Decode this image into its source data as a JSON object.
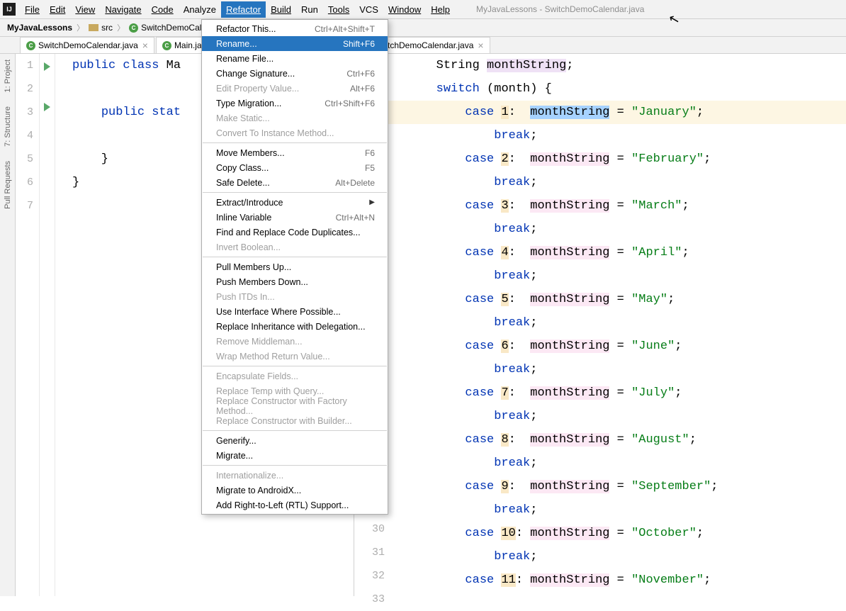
{
  "window": {
    "title": "MyJavaLessons - SwitchDemoCalendar.java"
  },
  "menus": {
    "file": "File",
    "edit": "Edit",
    "view": "View",
    "navigate": "Navigate",
    "code": "Code",
    "analyze": "Analyze",
    "refactor": "Refactor",
    "build": "Build",
    "run": "Run",
    "tools": "Tools",
    "vcs": "VCS",
    "window": "Window",
    "help": "Help"
  },
  "breadcrumb": {
    "project": "MyJavaLessons",
    "src": "src",
    "cls": "SwitchDemoCalendar"
  },
  "tabs": {
    "left1": "SwitchDemoCalendar.java",
    "left2": "Main.jav",
    "right1": "tchDemoCalendar.java"
  },
  "sidebar": {
    "project": "1: Project",
    "structure": "7: Structure",
    "pull": "Pull Requests"
  },
  "dropdown": [
    {
      "label": "Refactor This...",
      "short": "Ctrl+Alt+Shift+T",
      "type": "item"
    },
    {
      "label": "Rename...",
      "short": "Shift+F6",
      "type": "highlighted"
    },
    {
      "label": "Rename File...",
      "type": "item"
    },
    {
      "label": "Change Signature...",
      "short": "Ctrl+F6",
      "type": "item"
    },
    {
      "label": "Edit Property Value...",
      "short": "Alt+F6",
      "type": "disabled"
    },
    {
      "label": "Type Migration...",
      "short": "Ctrl+Shift+F6",
      "type": "item"
    },
    {
      "label": "Make Static...",
      "type": "disabled"
    },
    {
      "label": "Convert To Instance Method...",
      "type": "disabled"
    },
    {
      "type": "sep"
    },
    {
      "label": "Move Members...",
      "short": "F6",
      "type": "item"
    },
    {
      "label": "Copy Class...",
      "short": "F5",
      "type": "item"
    },
    {
      "label": "Safe Delete...",
      "short": "Alt+Delete",
      "type": "item"
    },
    {
      "type": "sep"
    },
    {
      "label": "Extract/Introduce",
      "type": "submenu"
    },
    {
      "label": "Inline Variable",
      "short": "Ctrl+Alt+N",
      "type": "item"
    },
    {
      "label": "Find and Replace Code Duplicates...",
      "type": "item"
    },
    {
      "label": "Invert Boolean...",
      "type": "disabled"
    },
    {
      "type": "sep"
    },
    {
      "label": "Pull Members Up...",
      "type": "item"
    },
    {
      "label": "Push Members Down...",
      "type": "item"
    },
    {
      "label": "Push ITDs In...",
      "type": "disabled"
    },
    {
      "label": "Use Interface Where Possible...",
      "type": "item"
    },
    {
      "label": "Replace Inheritance with Delegation...",
      "type": "item"
    },
    {
      "label": "Remove Middleman...",
      "type": "disabled"
    },
    {
      "label": "Wrap Method Return Value...",
      "type": "disabled"
    },
    {
      "type": "sep"
    },
    {
      "label": "Encapsulate Fields...",
      "type": "disabled"
    },
    {
      "label": "Replace Temp with Query...",
      "type": "disabled"
    },
    {
      "label": "Replace Constructor with Factory Method...",
      "type": "disabled"
    },
    {
      "label": "Replace Constructor with Builder...",
      "type": "disabled"
    },
    {
      "type": "sep"
    },
    {
      "label": "Generify...",
      "type": "item"
    },
    {
      "label": "Migrate...",
      "type": "item"
    },
    {
      "type": "sep"
    },
    {
      "label": "Internationalize...",
      "type": "disabled"
    },
    {
      "label": "Migrate to AndroidX...",
      "type": "item"
    },
    {
      "label": "Add Right-to-Left (RTL) Support...",
      "type": "item"
    }
  ],
  "leftCode": {
    "l1": {
      "kw": "public class ",
      "rest": "Ma"
    },
    "l3": {
      "kw": "public stat"
    },
    "l5": "    }",
    "l6": "}"
  },
  "rightLineStart": 29,
  "code_right": {
    "var": "monthString",
    "kw_string": "String",
    "kw_switch": "switch",
    "kw_case": "case",
    "kw_break": "break",
    "param": "month",
    "cases": [
      {
        "n": "1",
        "m": "January"
      },
      {
        "n": "2",
        "m": "February"
      },
      {
        "n": "3",
        "m": "March"
      },
      {
        "n": "4",
        "m": "April"
      },
      {
        "n": "5",
        "m": "May"
      },
      {
        "n": "6",
        "m": "June"
      },
      {
        "n": "7",
        "m": "July"
      },
      {
        "n": "8",
        "m": "August"
      },
      {
        "n": "9",
        "m": "September"
      },
      {
        "n": "10",
        "m": "October"
      },
      {
        "n": "11",
        "m": "November"
      }
    ]
  }
}
